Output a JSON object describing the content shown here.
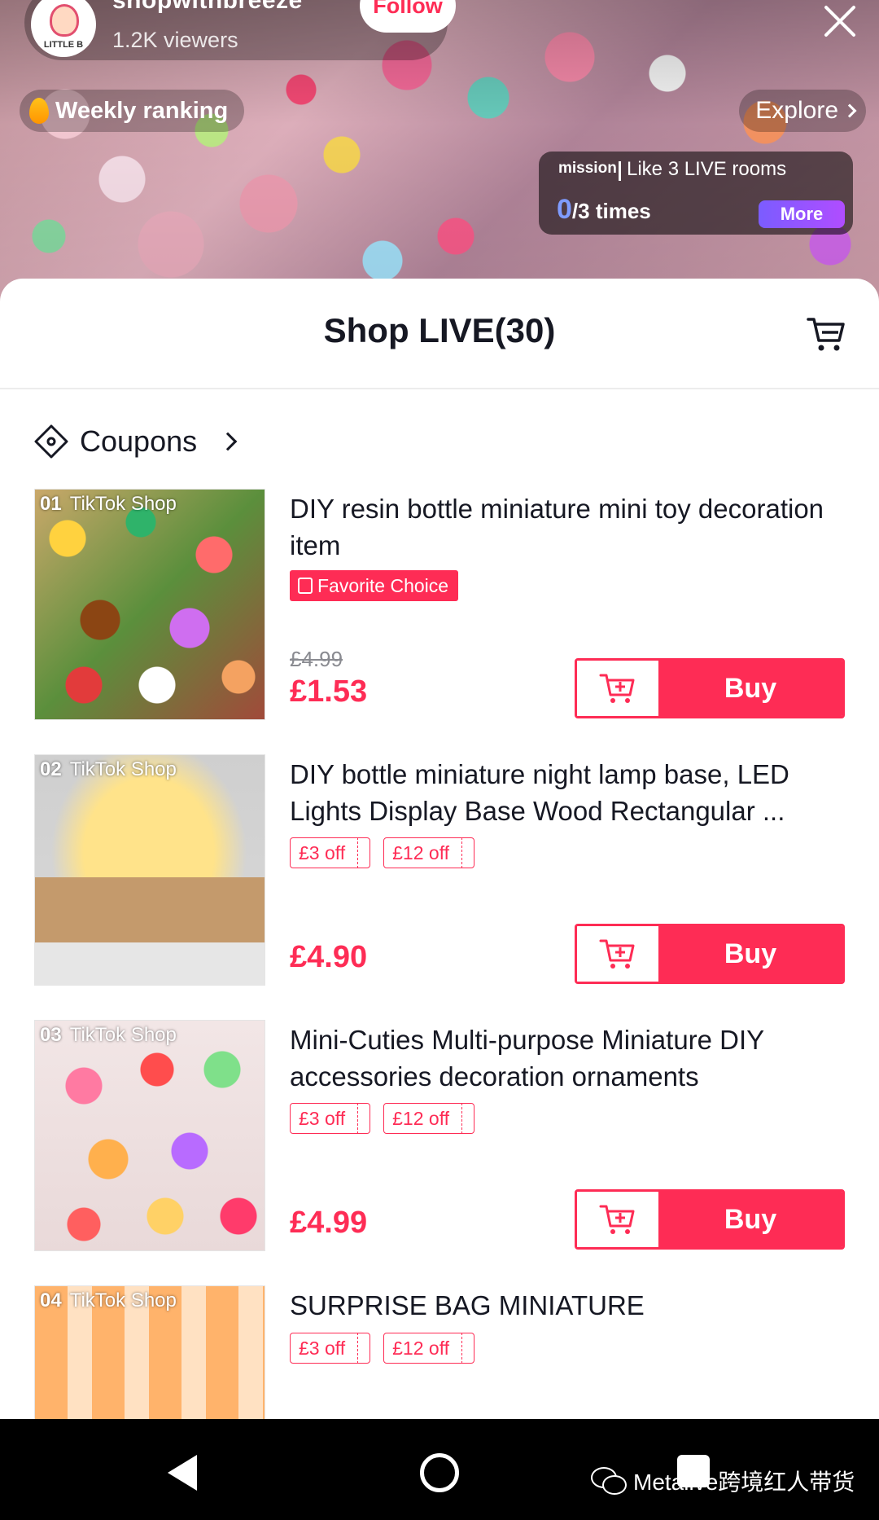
{
  "live": {
    "host_name": "shopwithbreeze",
    "avatar_brand": "LITTLE B",
    "viewers": "1.2K viewers",
    "follow_label": "Follow",
    "ranking_label": "Weekly ranking",
    "explore_label": "Explore",
    "mission": {
      "tag": "mission",
      "text": "Like 3 LIVE rooms",
      "current": "0",
      "total": "/3 times",
      "more_label": "More"
    }
  },
  "sheet": {
    "title": "Shop LIVE(30)",
    "coupons_label": "Coupons"
  },
  "products": [
    {
      "index": "01",
      "shop": "TikTok Shop",
      "title": "DIY resin bottle miniature mini toy decoration item",
      "badge": "Favorite Choice",
      "old_price": "£4.99",
      "price": "£1.53",
      "buy_label": "Buy"
    },
    {
      "index": "02",
      "shop": "TikTok Shop",
      "title": "DIY bottle miniature night lamp base, LED Lights Display Base Wood Rectangular ...",
      "coupons": [
        "£3 off",
        "£12 off"
      ],
      "price": "£4.90",
      "buy_label": "Buy"
    },
    {
      "index": "03",
      "shop": "TikTok Shop",
      "title": "Mini-Cuties Multi-purpose Miniature DIY accessories decoration ornaments",
      "coupons": [
        "£3 off",
        "£12 off"
      ],
      "price": "£4.99",
      "buy_label": "Buy"
    },
    {
      "index": "04",
      "shop": "TikTok Shop",
      "title": "SURPRISE BAG MINIATURE",
      "coupons": [
        "£3 off",
        "£12 off"
      ]
    }
  ],
  "watermark": "Metalive跨境红人带货",
  "colors": {
    "accent": "#fe2c55",
    "mission_button": "#9b5cff"
  }
}
